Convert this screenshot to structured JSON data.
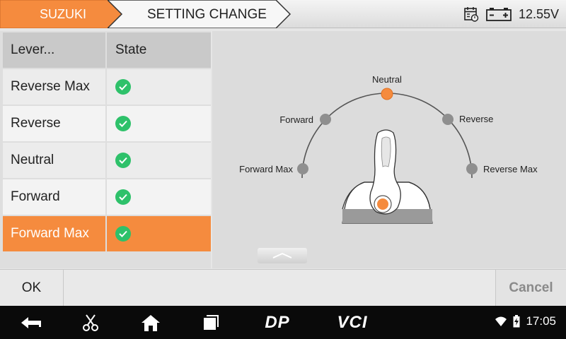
{
  "header": {
    "brand": "SUZUKI",
    "page_title": "SETTING CHANGE",
    "voltage": "12.55V",
    "icons": [
      "calendar-icon",
      "battery-icon"
    ]
  },
  "table": {
    "columns": [
      "Lever...",
      "State"
    ],
    "rows": [
      {
        "label": "Reverse Max",
        "state": "check"
      },
      {
        "label": "Reverse",
        "state": "check"
      },
      {
        "label": "Neutral",
        "state": "check"
      },
      {
        "label": "Forward",
        "state": "check"
      },
      {
        "label": "Forward Max",
        "state": "check",
        "selected": true
      }
    ]
  },
  "diagram": {
    "positions": [
      "Neutral",
      "Forward",
      "Reverse",
      "Forward Max",
      "Reverse Max"
    ],
    "active_position": "Neutral",
    "active_color": "#f58b3e",
    "inactive_color": "#8f8f8f"
  },
  "footer": {
    "ok_label": "OK",
    "cancel_label": "Cancel"
  },
  "navbar": {
    "dp_label": "DP",
    "vci_label": "VCI",
    "time": "17:05"
  },
  "colors": {
    "accent": "#f58b3e",
    "check": "#2ec16a"
  }
}
